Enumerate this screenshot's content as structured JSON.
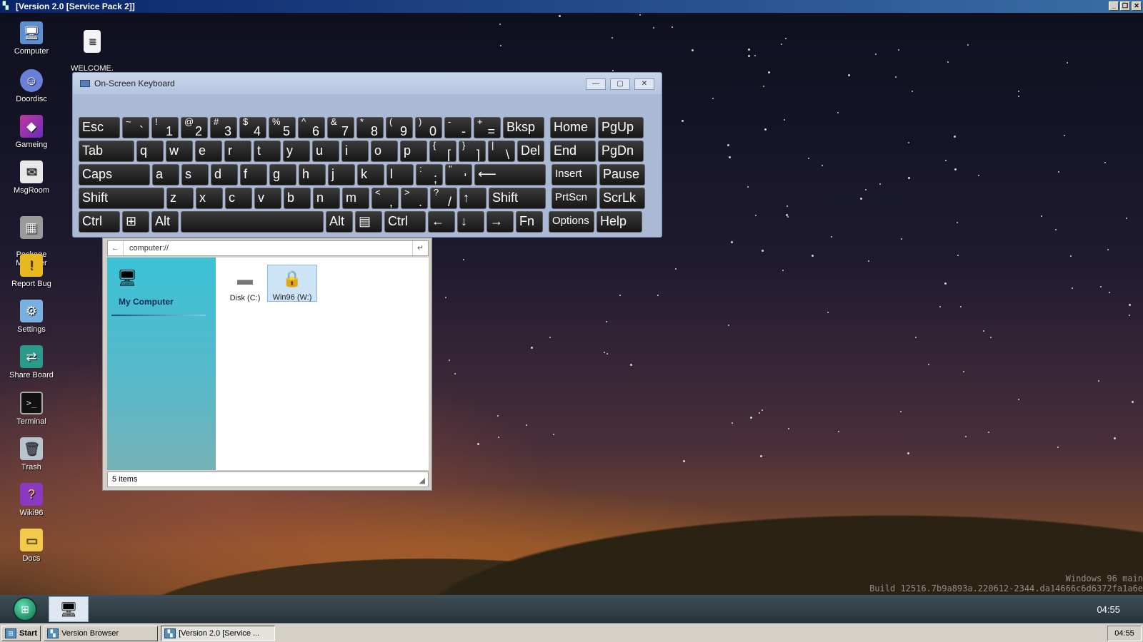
{
  "topbar": {
    "title": "[Version 2.0 [Service Pack 2]]"
  },
  "desktop_icons": [
    {
      "label": "Computer",
      "icon": "computer-icon"
    },
    {
      "label": "WELCOME.\nmd",
      "icon": "document-icon"
    },
    {
      "label": "Doordisc",
      "icon": "doordisc-icon"
    },
    {
      "label": "Gameing",
      "icon": "gaming-icon"
    },
    {
      "label": "MsgRoom",
      "icon": "msgroom-icon"
    },
    {
      "label": "Package\nManager",
      "icon": "package-icon"
    },
    {
      "label": "Report Bug",
      "icon": "bug-shield-icon"
    },
    {
      "label": "Settings",
      "icon": "settings-icon"
    },
    {
      "label": "Share Board",
      "icon": "share-icon"
    },
    {
      "label": "Terminal",
      "icon": "terminal-icon"
    },
    {
      "label": "Trash",
      "icon": "trash-icon"
    },
    {
      "label": "Wiki96",
      "icon": "book-icon"
    },
    {
      "label": "Docs",
      "icon": "folder-icon"
    }
  ],
  "osk": {
    "title": "On-Screen Keyboard",
    "rows": [
      [
        [
          "Esc",
          ""
        ],
        [
          "~",
          "`"
        ],
        [
          "!",
          "1"
        ],
        [
          "@",
          "2"
        ],
        [
          "#",
          "3"
        ],
        [
          "$",
          "4"
        ],
        [
          "%",
          "5"
        ],
        [
          "^",
          "6"
        ],
        [
          "&",
          "7"
        ],
        [
          "*",
          "8"
        ],
        [
          "(",
          "9"
        ],
        [
          ")",
          "0"
        ],
        [
          "-",
          "-"
        ],
        [
          "+",
          "="
        ],
        [
          "Bksp",
          ""
        ],
        [
          "Home",
          ""
        ],
        [
          "PgUp",
          ""
        ]
      ],
      [
        [
          "Tab",
          ""
        ],
        [
          "q",
          ""
        ],
        [
          "w",
          ""
        ],
        [
          "e",
          ""
        ],
        [
          "r",
          ""
        ],
        [
          "t",
          ""
        ],
        [
          "y",
          ""
        ],
        [
          "u",
          ""
        ],
        [
          "i",
          ""
        ],
        [
          "o",
          ""
        ],
        [
          "p",
          ""
        ],
        [
          "{",
          "["
        ],
        [
          "}",
          "]"
        ],
        [
          "|",
          "\\"
        ],
        [
          "Del",
          ""
        ],
        [
          "End",
          ""
        ],
        [
          "PgDn",
          ""
        ]
      ],
      [
        [
          "Caps",
          ""
        ],
        [
          "a",
          ""
        ],
        [
          "s",
          ""
        ],
        [
          "d",
          ""
        ],
        [
          "f",
          ""
        ],
        [
          "g",
          ""
        ],
        [
          "h",
          ""
        ],
        [
          "j",
          ""
        ],
        [
          "k",
          ""
        ],
        [
          "l",
          ""
        ],
        [
          ":",
          ";"
        ],
        [
          "\"",
          "'"
        ],
        [
          "⟵",
          ""
        ],
        [
          "Insert",
          ""
        ],
        [
          "Pause",
          ""
        ]
      ],
      [
        [
          "Shift",
          ""
        ],
        [
          "z",
          ""
        ],
        [
          "x",
          ""
        ],
        [
          "c",
          ""
        ],
        [
          "v",
          ""
        ],
        [
          "b",
          ""
        ],
        [
          "n",
          ""
        ],
        [
          "m",
          ""
        ],
        [
          "<",
          ","
        ],
        [
          ">",
          "."
        ],
        [
          "?",
          "/"
        ],
        [
          "↑",
          ""
        ],
        [
          "Shift",
          ""
        ],
        [
          "PrtScn",
          ""
        ],
        [
          "ScrLk",
          ""
        ]
      ],
      [
        [
          "Ctrl",
          ""
        ],
        [
          "⊞",
          ""
        ],
        [
          "Alt",
          ""
        ],
        [
          "",
          ""
        ],
        [
          "Alt",
          ""
        ],
        [
          "▤",
          ""
        ],
        [
          "Ctrl",
          ""
        ],
        [
          "←",
          ""
        ],
        [
          "↓",
          ""
        ],
        [
          "→",
          ""
        ],
        [
          "Fn",
          ""
        ],
        [
          "Options",
          ""
        ],
        [
          "Help",
          ""
        ]
      ]
    ]
  },
  "browser": {
    "address": "computer://",
    "sidebar_title": "My Computer",
    "files": [
      {
        "label": "Disk (C:)",
        "icon": "disk-icon"
      },
      {
        "label": "Win96 (W:)",
        "icon": "locked-drive-icon"
      }
    ],
    "status": "5 items"
  },
  "watermark": {
    "line1": "Windows 96 main",
    "line2": "Build 12516.7b9a893a.220612-2344.da14666c6d6372fa1a6e"
  },
  "panel": {
    "clock": "04:55"
  },
  "taskbar": {
    "start": "Start",
    "buttons": [
      "Version Browser",
      "[Version 2.0 [Service ..."
    ],
    "tray_time": "04:55"
  }
}
